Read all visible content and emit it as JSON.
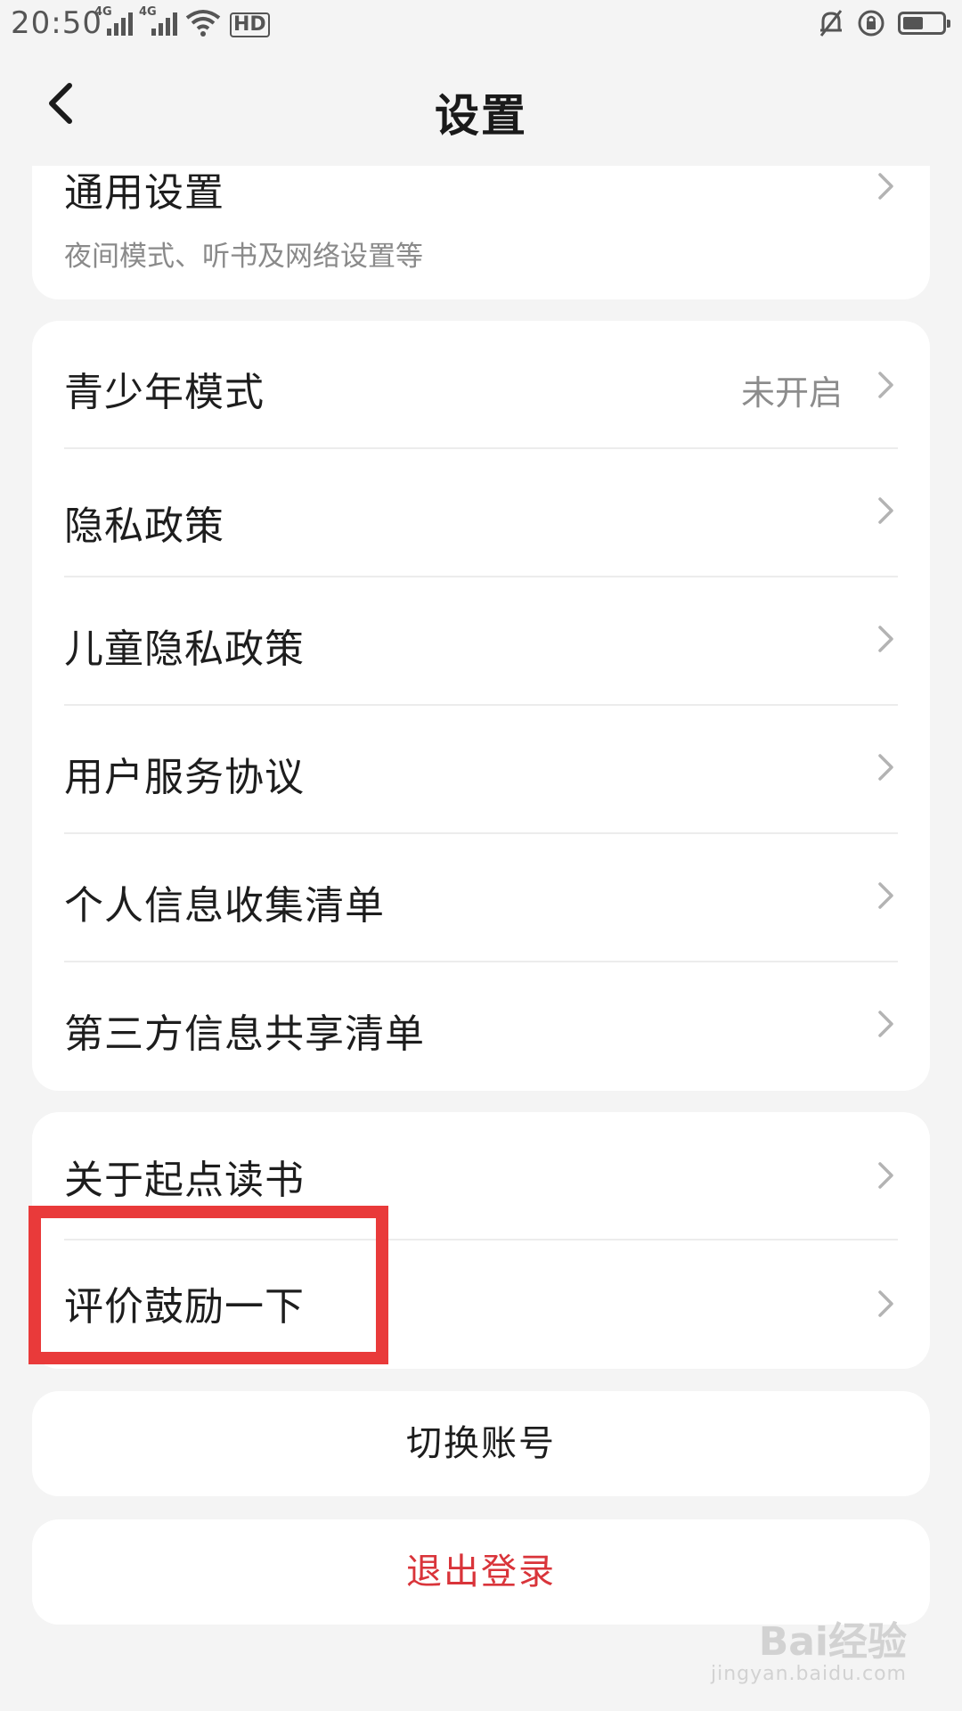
{
  "status_bar": {
    "time": "20:50",
    "network_1": "4G",
    "network_2": "4G",
    "hd_label": "HD",
    "icons": [
      "signal-icon",
      "wifi-icon",
      "hd-icon",
      "mute-bell-icon",
      "rotation-lock-icon",
      "battery-icon"
    ]
  },
  "header": {
    "title": "设置",
    "back_icon": "chevron-left-icon"
  },
  "general_card": {
    "label": "通用设置",
    "subtitle": "夜间模式、听书及网络设置等"
  },
  "policy_card": {
    "items": [
      {
        "label": "青少年模式",
        "value": "未开启"
      },
      {
        "label": "隐私政策"
      },
      {
        "label": "儿童隐私政策"
      },
      {
        "label": "用户服务协议"
      },
      {
        "label": "个人信息收集清单"
      },
      {
        "label": "第三方信息共享清单"
      }
    ]
  },
  "about_card": {
    "items": [
      {
        "label": "关于起点读书"
      },
      {
        "label": "评价鼓励一下"
      }
    ]
  },
  "buttons": {
    "switch_account": "切换账号",
    "logout": "退出登录"
  },
  "colors": {
    "logout_text": "#d9343a",
    "highlight_border": "#e93a3a"
  },
  "watermark": {
    "brand": "Bai经验",
    "url": "jingyan.baidu.com"
  }
}
